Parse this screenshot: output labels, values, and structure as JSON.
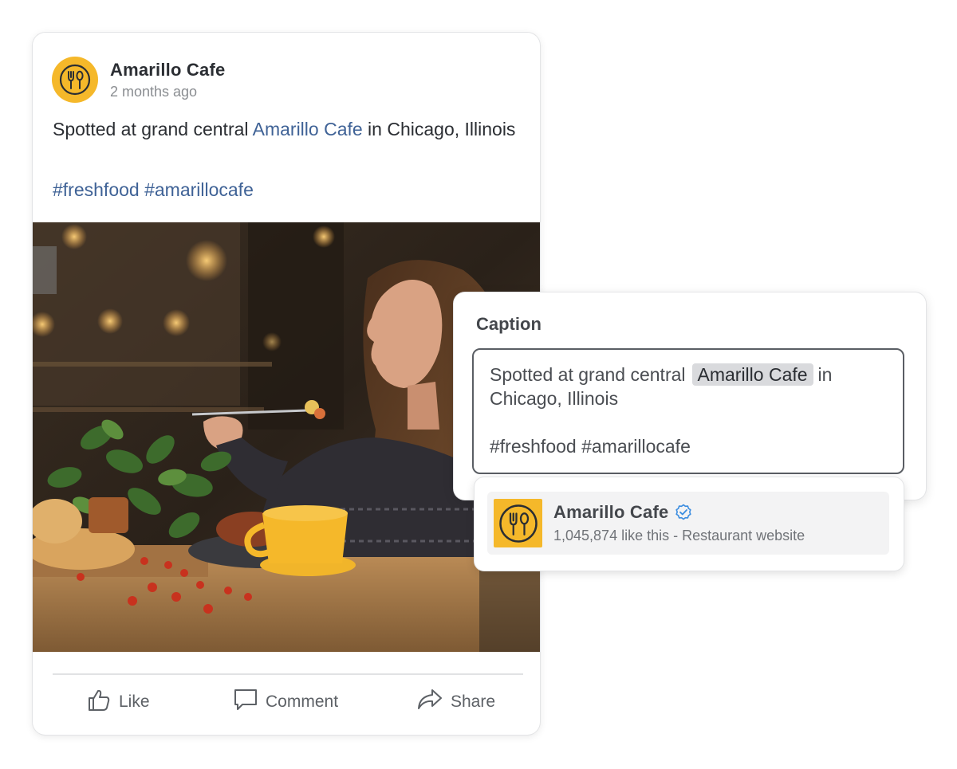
{
  "post": {
    "author": "Amarillo Cafe",
    "time": "2 months ago",
    "text_prefix": "Spotted at grand central ",
    "mention": "Amarillo Cafe",
    "text_suffix": " in Chicago, Illinois",
    "hashtags": "#freshfood #amarillocafe",
    "actions": {
      "like": "Like",
      "comment": "Comment",
      "share": "Share"
    }
  },
  "caption_panel": {
    "label": "Caption",
    "text_prefix": "Spotted at grand central",
    "mention": "Amarillo Cafe",
    "text_suffix": "in Chicago, Illinois",
    "hashtags": "#freshfood #amarillocafe"
  },
  "suggestion": {
    "name": "Amarillo Cafe",
    "meta": "1,045,874 like this - Restaurant website"
  },
  "colors": {
    "brand_yellow": "#f5b82a",
    "link_blue": "#3f6296",
    "verified_blue": "#3b8de0"
  },
  "icons": [
    "fork-spoon-logo-icon",
    "thumbs-up-icon",
    "comment-icon",
    "share-icon",
    "verified-check-icon"
  ]
}
